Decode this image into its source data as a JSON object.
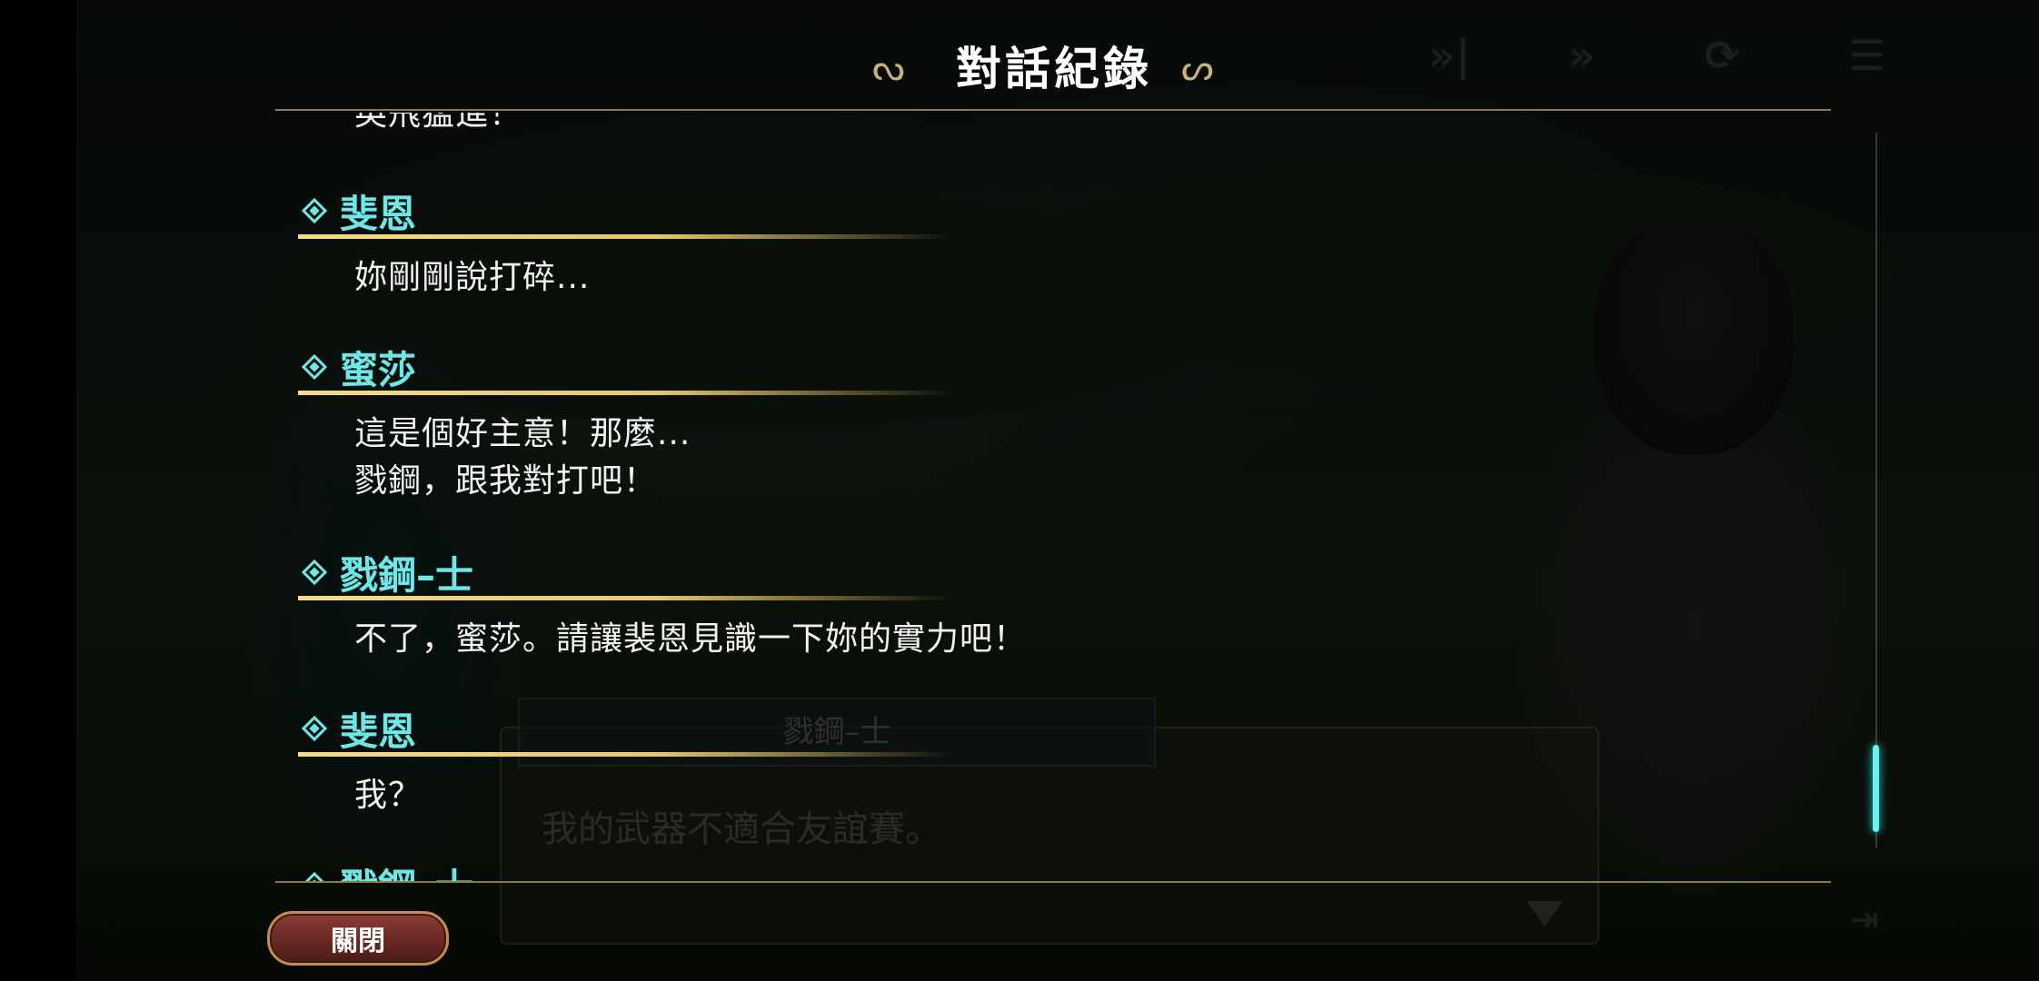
{
  "title": "對話紀錄",
  "title_flourish_left": "ᔓ",
  "title_flourish_right": "ᔕ",
  "controls": {
    "auto_icon": "»|",
    "fast_icon": "»",
    "skip_icon": "⟳",
    "menu_icon": "☰"
  },
  "log": {
    "partial_top_line": "英飛猛進！",
    "entries": [
      {
        "speaker": "斐恩",
        "lines": [
          "妳剛剛說打碎..."
        ]
      },
      {
        "speaker": "蜜莎",
        "lines": [
          "這是個好主意！那麼...",
          "戮鋼，跟我對打吧！"
        ]
      },
      {
        "speaker": "戮鋼–士",
        "lines": [
          "不了，蜜莎。請讓裴恩見識一下妳的實力吧！"
        ]
      },
      {
        "speaker": "斐恩",
        "lines": [
          "我？"
        ]
      },
      {
        "speaker": "戮鋼–士",
        "lines": []
      }
    ]
  },
  "background_dialog": {
    "speaker": "戮鋼–士",
    "text": "我的武器不適合友誼賽。"
  },
  "close_button": "關閉",
  "colors": {
    "speaker": "#6ee8e6",
    "underline": "#f4dc88",
    "scroll_thumb": "#6ff0f0",
    "close_button": "#6b2a26"
  }
}
